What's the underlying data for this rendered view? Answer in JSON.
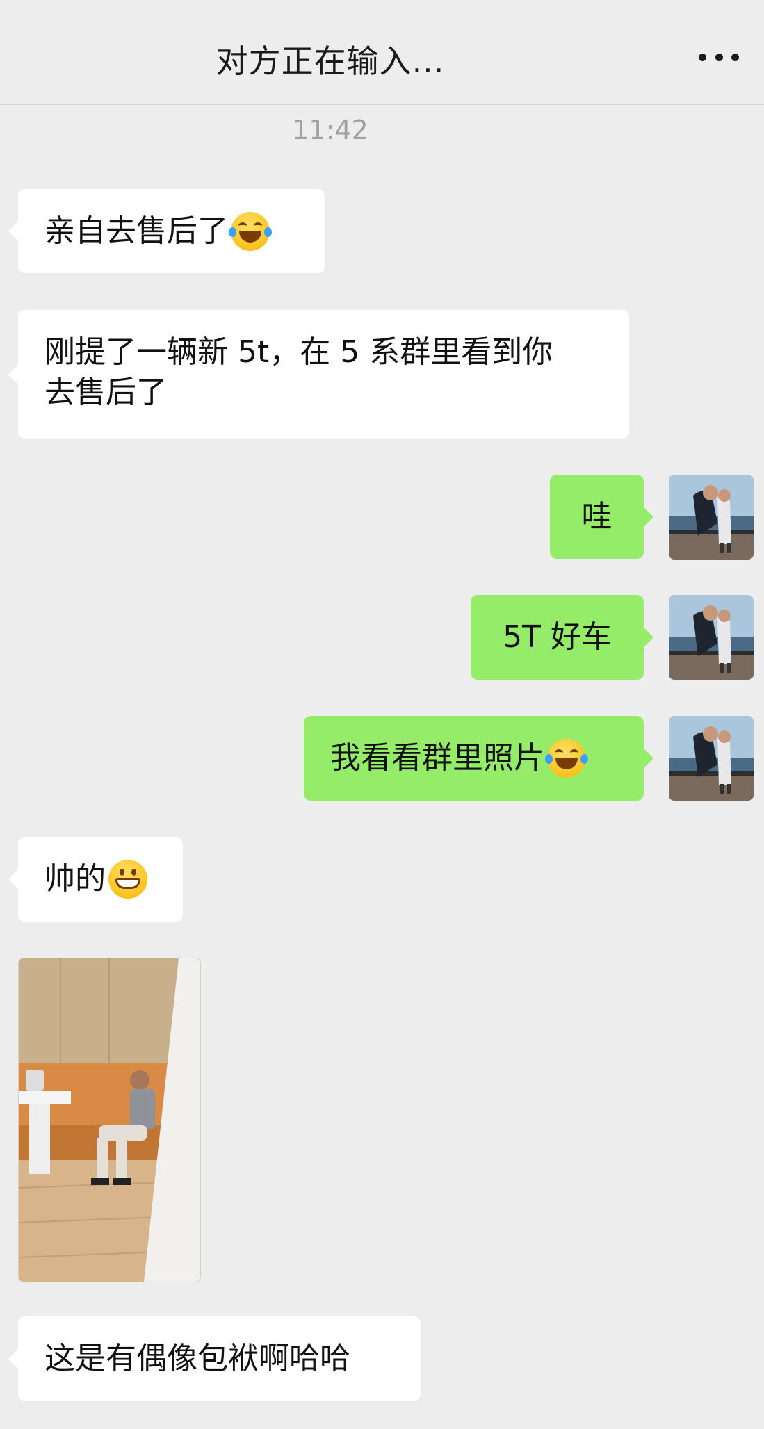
{
  "header": {
    "title": "对方正在输入..."
  },
  "timestamp": "11:42",
  "messages": [
    {
      "side": "in",
      "text": "亲自去售后了"
    },
    {
      "side": "in",
      "line1": "刚提了一辆新 5t，在 5 系群里看到你",
      "line2": "去售后了"
    },
    {
      "side": "out",
      "text": "哇"
    },
    {
      "side": "out",
      "text": "5T 好车"
    },
    {
      "side": "out",
      "text": "我看看群里照片"
    },
    {
      "side": "in",
      "text": "帅的"
    },
    {
      "side": "in",
      "type": "image"
    },
    {
      "side": "in",
      "text": "这是有偶像包袱啊哈哈"
    }
  ],
  "icons": {
    "more": "more-dots-icon",
    "laugh": "tears-of-joy-emoji",
    "grin": "grin-emoji"
  }
}
